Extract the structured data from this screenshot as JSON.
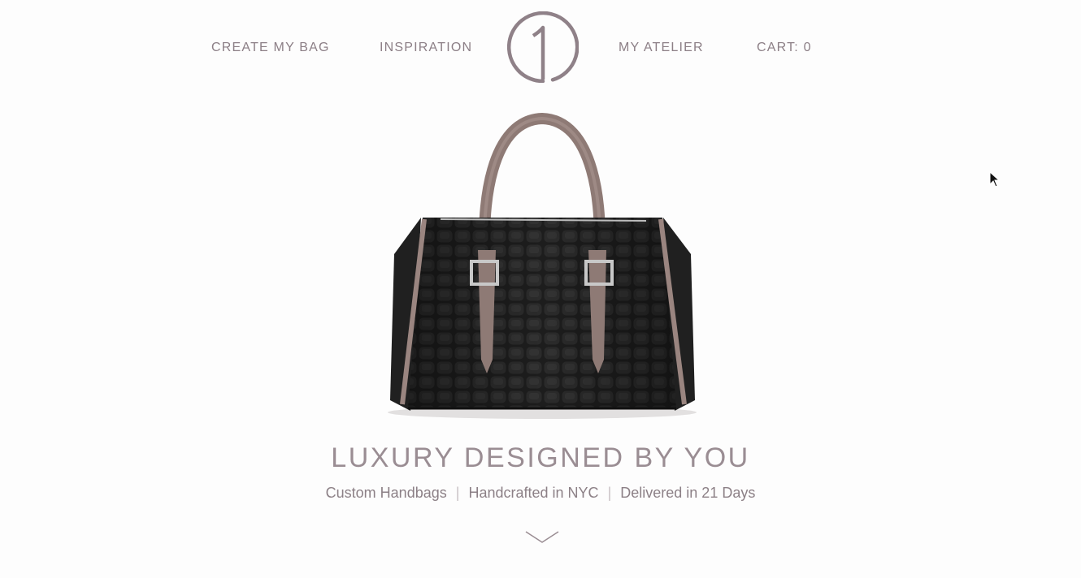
{
  "nav": {
    "create_my_bag": "CREATE MY BAG",
    "inspiration": "INSPIRATION",
    "my_atelier": "MY ATELIER",
    "cart": "CART: 0"
  },
  "logo": {
    "icon": "circle-one-logo-icon",
    "glyph": "1"
  },
  "hero": {
    "image": "black-crocodile-handbag-with-taupe-handles",
    "tagline": "LUXURY DESIGNED BY YOU",
    "features": [
      "Custom Handbags",
      "Handcrafted in NYC",
      "Delivered in 21 Days"
    ],
    "separator": "|"
  },
  "scroll": {
    "icon": "chevron-down-icon"
  },
  "colors": {
    "accent": "#8c7f86",
    "background": "#fdfdfd",
    "bag_body": "#1c1c1c",
    "bag_trim": "#9a8580"
  }
}
